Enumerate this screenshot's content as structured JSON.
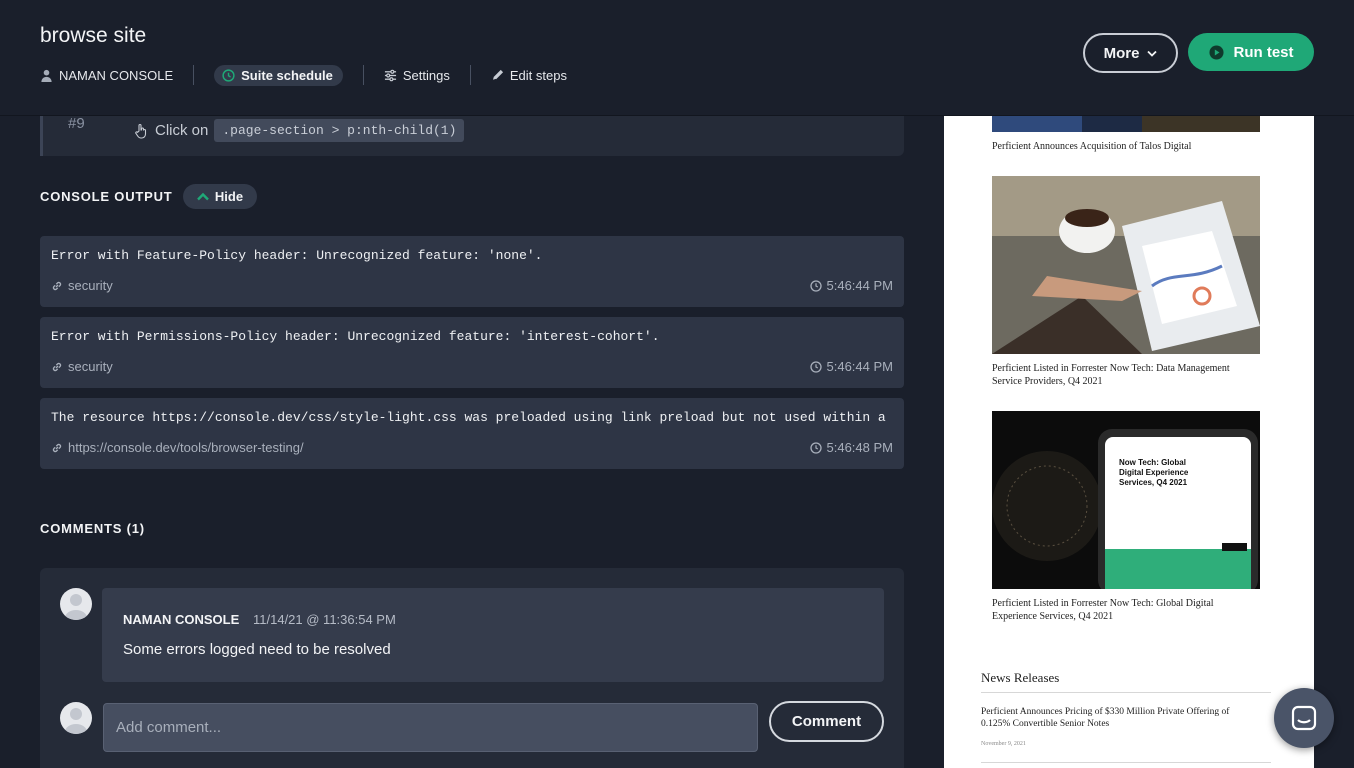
{
  "header": {
    "title": "browse site",
    "user": "NAMAN CONSOLE",
    "schedule_label": "Suite schedule",
    "settings_label": "Settings",
    "edit_steps_label": "Edit steps",
    "more_label": "More",
    "run_label": "Run test"
  },
  "step": {
    "number": "#9",
    "action": "Click on",
    "selector": ".page-section > p:nth-child(1)"
  },
  "console": {
    "heading": "CONSOLE OUTPUT",
    "toggle_label": "Hide",
    "entries": [
      {
        "message": "Error with Feature-Policy header: Unrecognized feature: 'none'.",
        "source": "security",
        "time": "5:46:44 PM"
      },
      {
        "message": "Error with Permissions-Policy header: Unrecognized feature: 'interest-cohort'.",
        "source": "security",
        "time": "5:46:44 PM"
      },
      {
        "message": "The resource https://console.dev/css/style-light.css was preloaded using link preload but not used within a",
        "source": "https://console.dev/tools/browser-testing/",
        "time": "5:46:48 PM"
      }
    ]
  },
  "comments": {
    "heading": "COMMENTS (1)",
    "items": [
      {
        "author": "NAMAN CONSOLE",
        "date": "11/14/21 @ 11:36:54 PM",
        "text": "Some errors logged need to be resolved"
      }
    ],
    "input_placeholder": "Add comment...",
    "submit_label": "Comment"
  },
  "preview": {
    "captions": [
      "Perficient Announces Acquisition of Talos Digital",
      "Perficient Listed in Forrester Now Tech: Data Management Service Providers, Q4 2021",
      "Perficient Listed in Forrester Now Tech: Global Digital Experience Services, Q4 2021"
    ],
    "phone_title": "Now Tech: Global Digital Experience Services, Q4 2021",
    "news_heading": "News Releases",
    "news_item": "Perficient Announces Pricing of $330 Million Private Offering of 0.125% Convertible Senior Notes",
    "news_date": "November 9, 2021"
  },
  "colors": {
    "accent_green": "#1fa877",
    "background": "#1a1f2b",
    "panel": "#2e3545"
  }
}
